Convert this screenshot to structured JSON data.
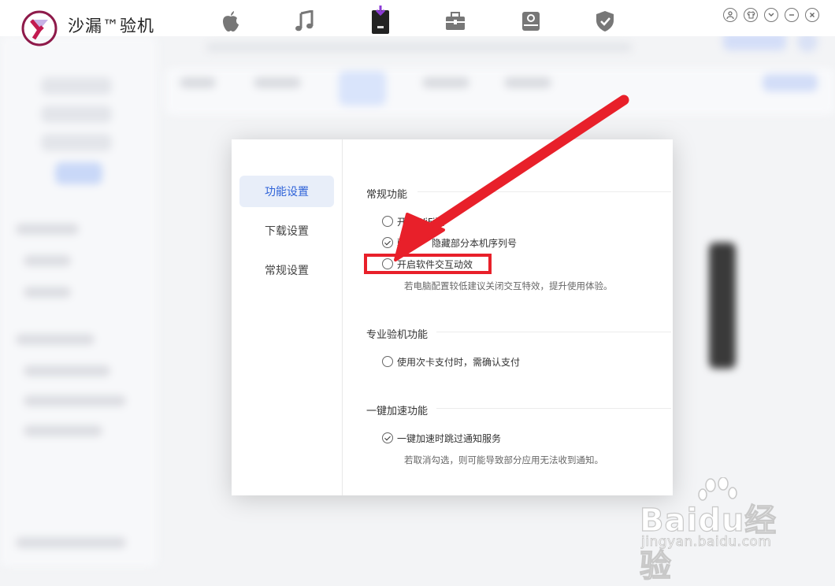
{
  "app": {
    "title": "沙漏™验机",
    "brand_color": "#8e1a4a"
  },
  "nav": {
    "icons": [
      "apple-icon",
      "music-icon",
      "device-download-icon",
      "toolbox-icon",
      "backup-icon",
      "shield-icon"
    ]
  },
  "window_controls": [
    "user-icon",
    "shirt-icon",
    "chevron-down-icon",
    "minimize-icon",
    "close-icon"
  ],
  "settings": {
    "sidebar": [
      {
        "label": "功能设置",
        "active": true
      },
      {
        "label": "下载设置",
        "active": false
      },
      {
        "label": "常规设置",
        "active": false
      }
    ],
    "sections": {
      "general": {
        "title": "常规功能",
        "options": [
          {
            "label": "开启WiFi连",
            "checked": false
          },
          {
            "label": "验机",
            "label_tail": "隐藏部分本机序列号",
            "checked": true
          },
          {
            "label": "开启软件交互动效",
            "checked": false
          }
        ],
        "hint": "若电脑配置较低建议关闭交互特效，提升使用体验。"
      },
      "pro": {
        "title": "专业验机功能",
        "options": [
          {
            "label": "使用次卡支付时，需确认支付",
            "checked": false
          }
        ]
      },
      "accel": {
        "title": "一键加速功能",
        "options": [
          {
            "label": "一键加速时跳过通知服务",
            "checked": true
          }
        ],
        "hint": "若取消勾选，则可能导致部分应用无法收到通知。"
      }
    },
    "accent_color": "#2f63d8"
  },
  "annotation": {
    "color": "#e8202a"
  },
  "watermark": {
    "big": "Baidu经验",
    "small": "jingyan.baidu.com"
  }
}
